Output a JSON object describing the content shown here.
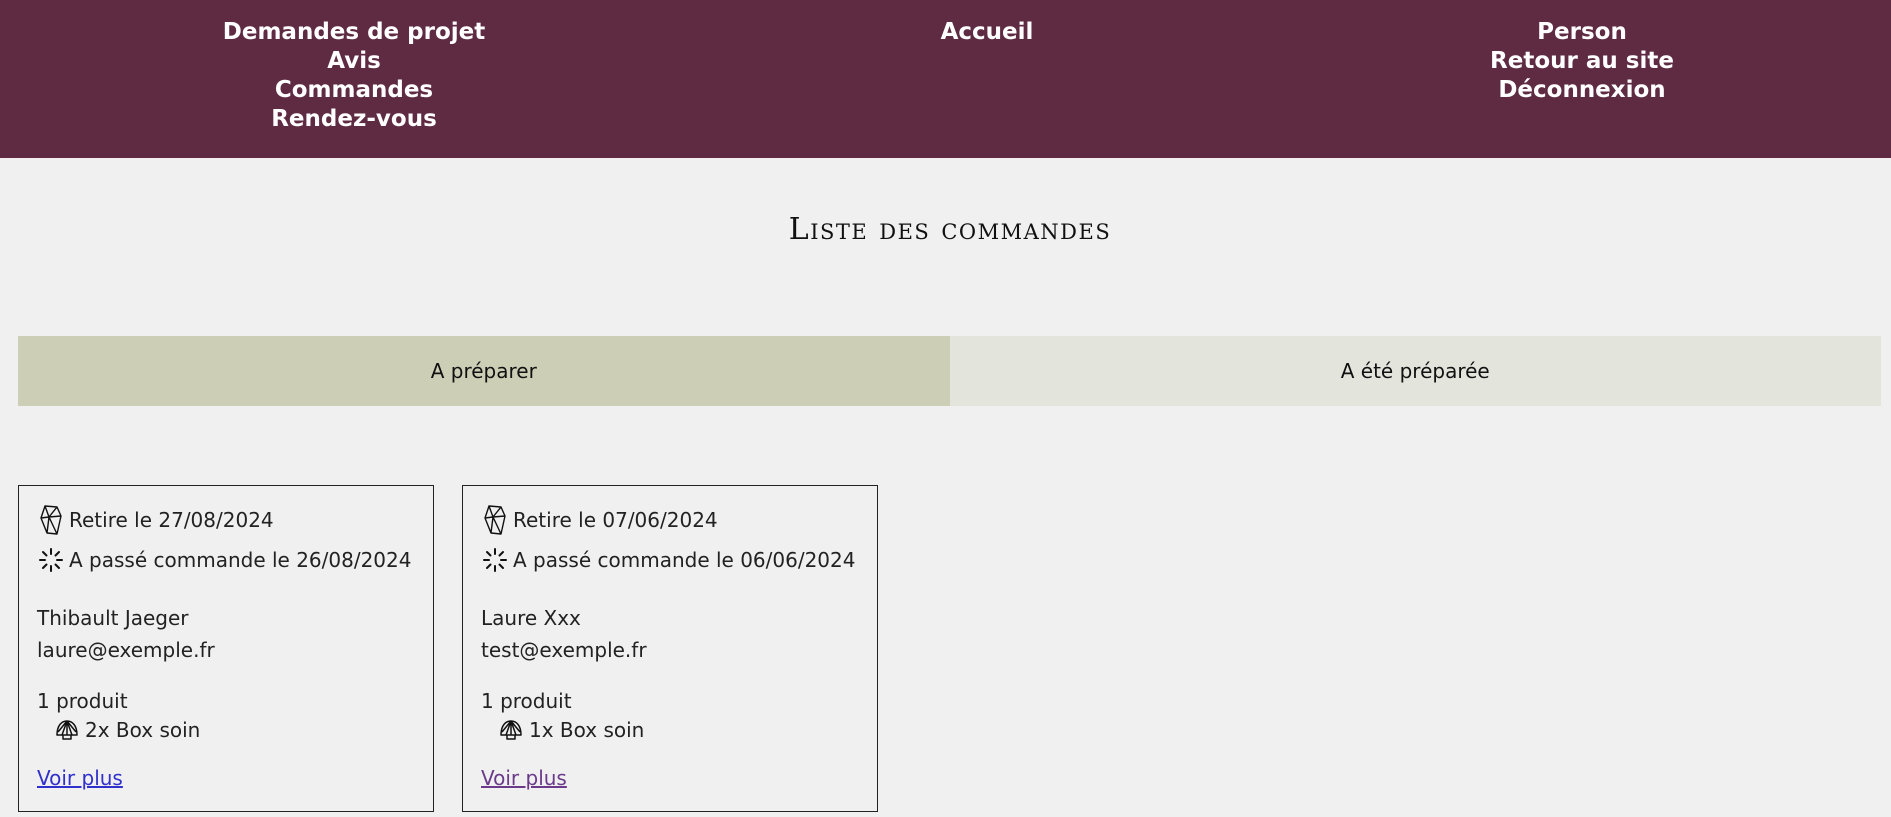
{
  "nav": {
    "left": [
      "Demandes de projet",
      "Avis",
      "Commandes",
      "Rendez-vous"
    ],
    "center": [
      "Accueil"
    ],
    "right": [
      "Person",
      "Retour au site",
      "Déconnexion"
    ]
  },
  "page": {
    "title": "Liste des commandes"
  },
  "tabs": [
    {
      "label": "A préparer",
      "active": true
    },
    {
      "label": "A été préparée",
      "active": false
    }
  ],
  "orders": [
    {
      "pickup": "Retire le 27/08/2024",
      "ordered": "A passé commande le 26/08/2024",
      "customer": "Thibault Jaeger",
      "email": "laure@exemple.fr",
      "product_count": "1 produit",
      "item": "2x Box soin",
      "link": "Voir plus"
    },
    {
      "pickup": "Retire le 07/06/2024",
      "ordered": "A passé commande le 06/06/2024",
      "customer": "Laure Xxx",
      "email": "test@exemple.fr",
      "product_count": "1 produit",
      "item": "1x Box soin",
      "link": "Voir plus"
    }
  ],
  "icons": {
    "pickup": "crystal-icon",
    "ordered": "loader-icon",
    "item": "shell-icon"
  },
  "colors": {
    "header": "#5e2b43",
    "tab_active": "#cccfb5",
    "tab_inactive": "#e3e4dc",
    "link": "#3030cc",
    "link_visited": "#6b3a8a"
  }
}
